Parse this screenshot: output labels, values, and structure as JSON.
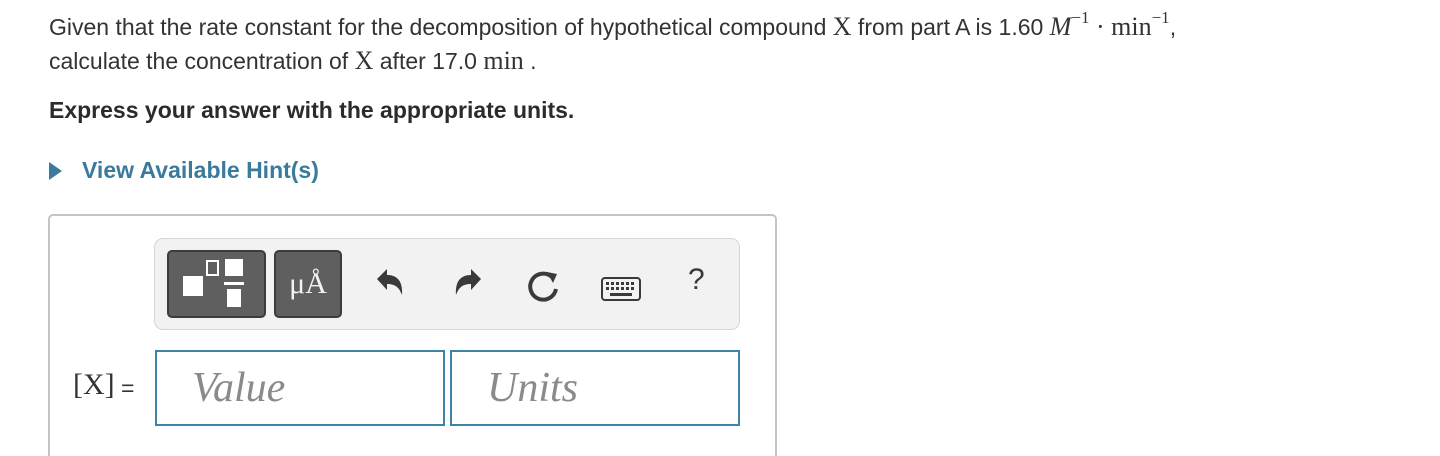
{
  "question": {
    "part1": "Given that the rate constant for the decomposition of hypothetical compound ",
    "compound": "X",
    "part2": " from part A is 1.60 ",
    "unit_M": "M",
    "exp1": "−1",
    "dot": " · ",
    "unit_min": "min",
    "exp2": "−1",
    "comma": ",",
    "part3": "calculate the concentration of ",
    "compound2": "X",
    "part4": " after 17.0 ",
    "unit_min2": "min",
    "period": " ."
  },
  "instruction": "Express your answer with the appropriate units.",
  "hint_label": "View Available Hint(s)",
  "toolbar": {
    "units_label": "μÅ",
    "help_label": "?"
  },
  "answer": {
    "variable_label": "[X]",
    "equals": "=",
    "value_placeholder": "Value",
    "units_placeholder": "Units"
  },
  "colors": {
    "accent": "#3a7a9c",
    "field_border": "#3f83a7",
    "button_dark": "#5f5f5f"
  }
}
